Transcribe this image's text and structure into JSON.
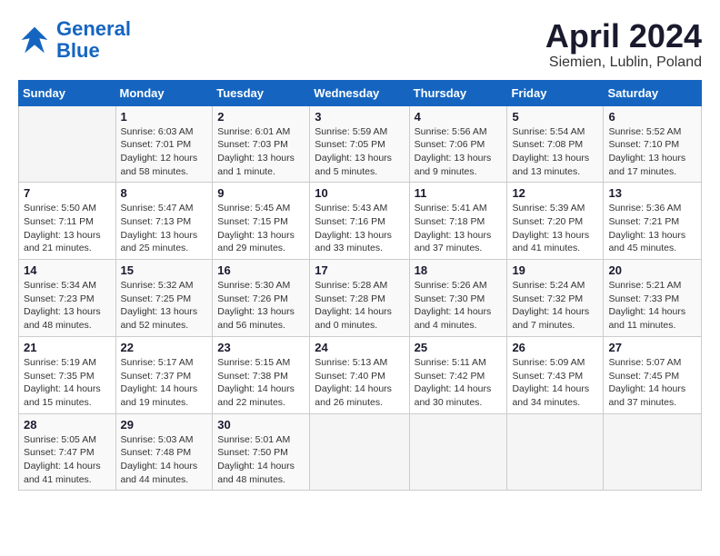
{
  "logo": {
    "line1": "General",
    "line2": "Blue"
  },
  "title": "April 2024",
  "subtitle": "Siemien, Lublin, Poland",
  "days_of_week": [
    "Sunday",
    "Monday",
    "Tuesday",
    "Wednesday",
    "Thursday",
    "Friday",
    "Saturday"
  ],
  "weeks": [
    [
      {
        "day": "",
        "info": ""
      },
      {
        "day": "1",
        "info": "Sunrise: 6:03 AM\nSunset: 7:01 PM\nDaylight: 12 hours\nand 58 minutes."
      },
      {
        "day": "2",
        "info": "Sunrise: 6:01 AM\nSunset: 7:03 PM\nDaylight: 13 hours\nand 1 minute."
      },
      {
        "day": "3",
        "info": "Sunrise: 5:59 AM\nSunset: 7:05 PM\nDaylight: 13 hours\nand 5 minutes."
      },
      {
        "day": "4",
        "info": "Sunrise: 5:56 AM\nSunset: 7:06 PM\nDaylight: 13 hours\nand 9 minutes."
      },
      {
        "day": "5",
        "info": "Sunrise: 5:54 AM\nSunset: 7:08 PM\nDaylight: 13 hours\nand 13 minutes."
      },
      {
        "day": "6",
        "info": "Sunrise: 5:52 AM\nSunset: 7:10 PM\nDaylight: 13 hours\nand 17 minutes."
      }
    ],
    [
      {
        "day": "7",
        "info": "Sunrise: 5:50 AM\nSunset: 7:11 PM\nDaylight: 13 hours\nand 21 minutes."
      },
      {
        "day": "8",
        "info": "Sunrise: 5:47 AM\nSunset: 7:13 PM\nDaylight: 13 hours\nand 25 minutes."
      },
      {
        "day": "9",
        "info": "Sunrise: 5:45 AM\nSunset: 7:15 PM\nDaylight: 13 hours\nand 29 minutes."
      },
      {
        "day": "10",
        "info": "Sunrise: 5:43 AM\nSunset: 7:16 PM\nDaylight: 13 hours\nand 33 minutes."
      },
      {
        "day": "11",
        "info": "Sunrise: 5:41 AM\nSunset: 7:18 PM\nDaylight: 13 hours\nand 37 minutes."
      },
      {
        "day": "12",
        "info": "Sunrise: 5:39 AM\nSunset: 7:20 PM\nDaylight: 13 hours\nand 41 minutes."
      },
      {
        "day": "13",
        "info": "Sunrise: 5:36 AM\nSunset: 7:21 PM\nDaylight: 13 hours\nand 45 minutes."
      }
    ],
    [
      {
        "day": "14",
        "info": "Sunrise: 5:34 AM\nSunset: 7:23 PM\nDaylight: 13 hours\nand 48 minutes."
      },
      {
        "day": "15",
        "info": "Sunrise: 5:32 AM\nSunset: 7:25 PM\nDaylight: 13 hours\nand 52 minutes."
      },
      {
        "day": "16",
        "info": "Sunrise: 5:30 AM\nSunset: 7:26 PM\nDaylight: 13 hours\nand 56 minutes."
      },
      {
        "day": "17",
        "info": "Sunrise: 5:28 AM\nSunset: 7:28 PM\nDaylight: 14 hours\nand 0 minutes."
      },
      {
        "day": "18",
        "info": "Sunrise: 5:26 AM\nSunset: 7:30 PM\nDaylight: 14 hours\nand 4 minutes."
      },
      {
        "day": "19",
        "info": "Sunrise: 5:24 AM\nSunset: 7:32 PM\nDaylight: 14 hours\nand 7 minutes."
      },
      {
        "day": "20",
        "info": "Sunrise: 5:21 AM\nSunset: 7:33 PM\nDaylight: 14 hours\nand 11 minutes."
      }
    ],
    [
      {
        "day": "21",
        "info": "Sunrise: 5:19 AM\nSunset: 7:35 PM\nDaylight: 14 hours\nand 15 minutes."
      },
      {
        "day": "22",
        "info": "Sunrise: 5:17 AM\nSunset: 7:37 PM\nDaylight: 14 hours\nand 19 minutes."
      },
      {
        "day": "23",
        "info": "Sunrise: 5:15 AM\nSunset: 7:38 PM\nDaylight: 14 hours\nand 22 minutes."
      },
      {
        "day": "24",
        "info": "Sunrise: 5:13 AM\nSunset: 7:40 PM\nDaylight: 14 hours\nand 26 minutes."
      },
      {
        "day": "25",
        "info": "Sunrise: 5:11 AM\nSunset: 7:42 PM\nDaylight: 14 hours\nand 30 minutes."
      },
      {
        "day": "26",
        "info": "Sunrise: 5:09 AM\nSunset: 7:43 PM\nDaylight: 14 hours\nand 34 minutes."
      },
      {
        "day": "27",
        "info": "Sunrise: 5:07 AM\nSunset: 7:45 PM\nDaylight: 14 hours\nand 37 minutes."
      }
    ],
    [
      {
        "day": "28",
        "info": "Sunrise: 5:05 AM\nSunset: 7:47 PM\nDaylight: 14 hours\nand 41 minutes."
      },
      {
        "day": "29",
        "info": "Sunrise: 5:03 AM\nSunset: 7:48 PM\nDaylight: 14 hours\nand 44 minutes."
      },
      {
        "day": "30",
        "info": "Sunrise: 5:01 AM\nSunset: 7:50 PM\nDaylight: 14 hours\nand 48 minutes."
      },
      {
        "day": "",
        "info": ""
      },
      {
        "day": "",
        "info": ""
      },
      {
        "day": "",
        "info": ""
      },
      {
        "day": "",
        "info": ""
      }
    ]
  ]
}
